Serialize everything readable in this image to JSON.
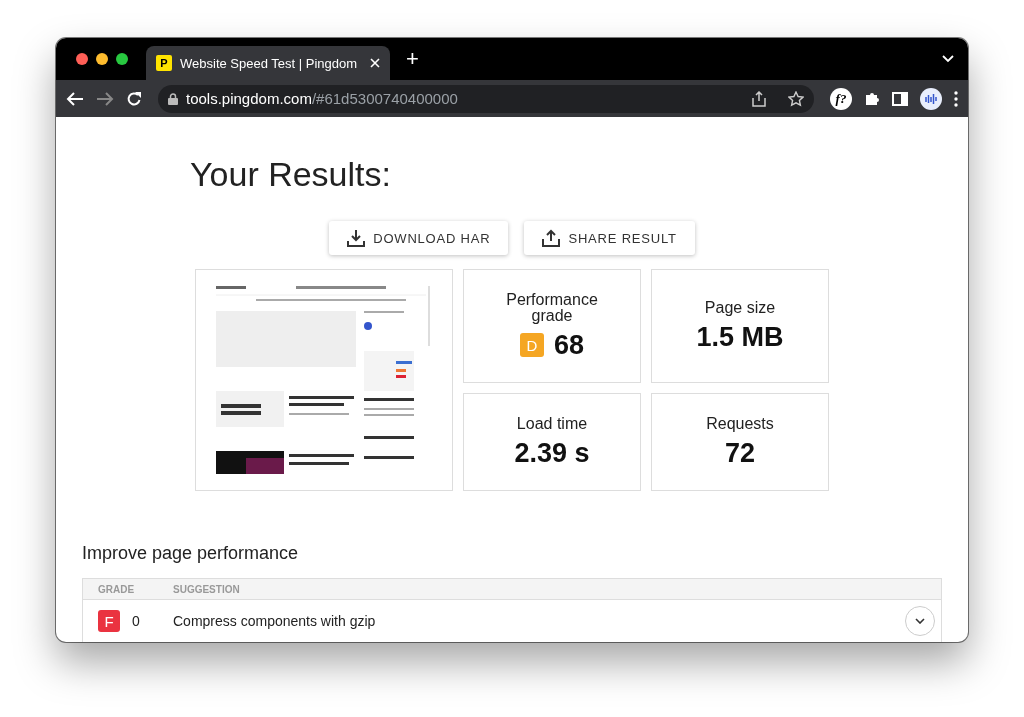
{
  "browser": {
    "tabs": [
      {
        "title": "Website Speed Test | Pingdom",
        "favicon": "P",
        "selected": true
      }
    ],
    "new_tab": "+",
    "address": {
      "host": "tools.pingdom.com",
      "path": "/#61d5300740400000"
    },
    "extension_label": "f?"
  },
  "page": {
    "heading": "Your Results:",
    "actions": [
      {
        "label": "DOWNLOAD HAR",
        "kind": "download"
      },
      {
        "label": "SHARE RESULT",
        "kind": "share"
      }
    ],
    "metrics": [
      {
        "label": "Performance grade",
        "value": "68",
        "grade": "D",
        "color": "#f5a623"
      },
      {
        "label": "Page size",
        "value": "1.5 MB"
      },
      {
        "label": "Load time",
        "value": "2.39 s"
      },
      {
        "label": "Requests",
        "value": "72"
      }
    ],
    "improve": {
      "title": "Improve page performance",
      "columns": [
        "GRADE",
        "SUGGESTION"
      ],
      "rows": [
        {
          "grade": "F",
          "color": "#ea3340",
          "score": "0",
          "suggestion": "Compress components with gzip",
          "expanded": false
        }
      ]
    }
  }
}
